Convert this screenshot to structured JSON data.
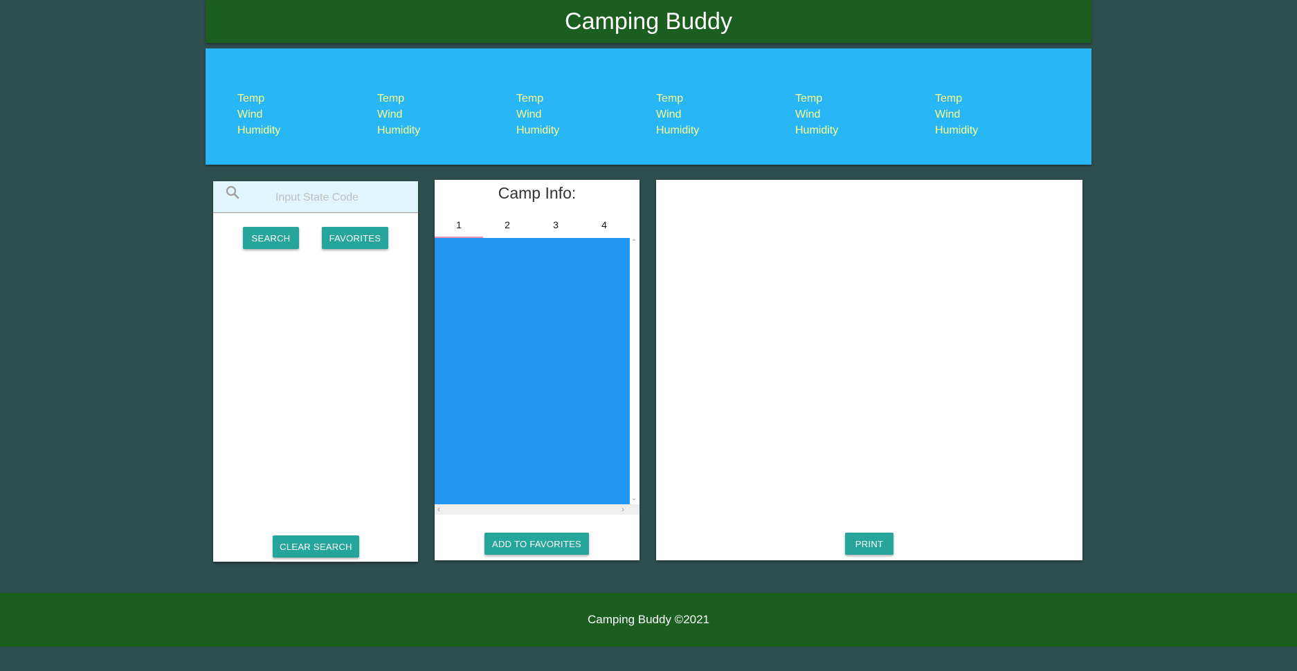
{
  "header": {
    "title": "Camping Buddy"
  },
  "forecast": {
    "days": [
      {
        "temp_label": "Temp",
        "wind_label": "Wind",
        "humidity_label": "Humidity"
      },
      {
        "temp_label": "Temp",
        "wind_label": "Wind",
        "humidity_label": "Humidity"
      },
      {
        "temp_label": "Temp",
        "wind_label": "Wind",
        "humidity_label": "Humidity"
      },
      {
        "temp_label": "Temp",
        "wind_label": "Wind",
        "humidity_label": "Humidity"
      },
      {
        "temp_label": "Temp",
        "wind_label": "Wind",
        "humidity_label": "Humidity"
      },
      {
        "temp_label": "Temp",
        "wind_label": "Wind",
        "humidity_label": "Humidity"
      }
    ]
  },
  "search": {
    "icon": "search-icon",
    "input_value": "",
    "placeholder": "Input State Code",
    "search_label": "SEARCH",
    "favorites_label": "FAVORITES",
    "clear_label": "CLEAR SEARCH"
  },
  "camp": {
    "title": "Camp Info:",
    "tabs": [
      "1",
      "2",
      "3",
      "4"
    ],
    "active_tab": "1",
    "add_favorites_label": "ADD TO FAVORITES"
  },
  "detail": {
    "print_label": "PRINT"
  },
  "footer": {
    "text": "Camping Buddy ©2021"
  },
  "colors": {
    "background": "#2f4f4f",
    "header_green": "#1b5e20",
    "forecast_blue": "#29b6f6",
    "forecast_text": "#ffff8d",
    "button_teal": "#26a69a",
    "camp_content_blue": "#2196f3",
    "tab_indicator": "#f48fb1"
  }
}
